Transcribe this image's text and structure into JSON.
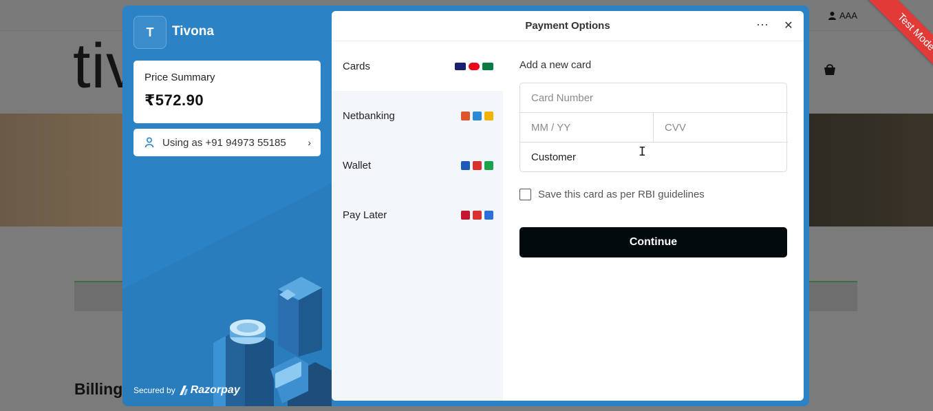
{
  "background": {
    "account_label": "AAA",
    "logo_text": "tiv",
    "billing_heading": "Billing"
  },
  "ribbon": {
    "label": "Test Mode"
  },
  "sidebar": {
    "brand_initial": "T",
    "brand_name": "Tivona",
    "price_label": "Price Summary",
    "price_value": "₹572.90",
    "contact_text": "Using as +91 94973 55185",
    "secured_by": "Secured by",
    "razorpay_label": "Razorpay"
  },
  "panel": {
    "title": "Payment Options",
    "menu_icon": "more-horizontal-icon",
    "close_icon": "close-icon"
  },
  "methods": [
    {
      "label": "Cards",
      "icons": [
        "visa-icon",
        "mastercard-icon",
        "rupay-icon"
      ],
      "colors": [
        "#1a1f71",
        "#eb001b",
        "#097a44"
      ]
    },
    {
      "label": "Netbanking",
      "icons": [
        "bank-icon",
        "bank-icon",
        "bank-icon"
      ],
      "colors": [
        "#e0552c",
        "#2b8ad8",
        "#f0b400"
      ]
    },
    {
      "label": "Wallet",
      "icons": [
        "wallet-icon",
        "wallet-icon",
        "wallet-icon"
      ],
      "colors": [
        "#1e5bb8",
        "#d9322e",
        "#1ba24b"
      ]
    },
    {
      "label": "Pay Later",
      "icons": [
        "paylater-icon",
        "paylater-icon",
        "paylater-icon"
      ],
      "colors": [
        "#c4162d",
        "#d9322e",
        "#2b6fd8"
      ]
    }
  ],
  "form": {
    "title": "Add a new card",
    "card_number_placeholder": "Card Number",
    "expiry_placeholder": "MM / YY",
    "cvv_placeholder": "CVV",
    "name_value": "Customer",
    "save_label": "Save this card as per RBI guidelines",
    "continue_label": "Continue"
  },
  "colors": {
    "modal_blue": "#2b83c6",
    "button_dark": "#020a0e",
    "ribbon_red": "#e23a36"
  }
}
